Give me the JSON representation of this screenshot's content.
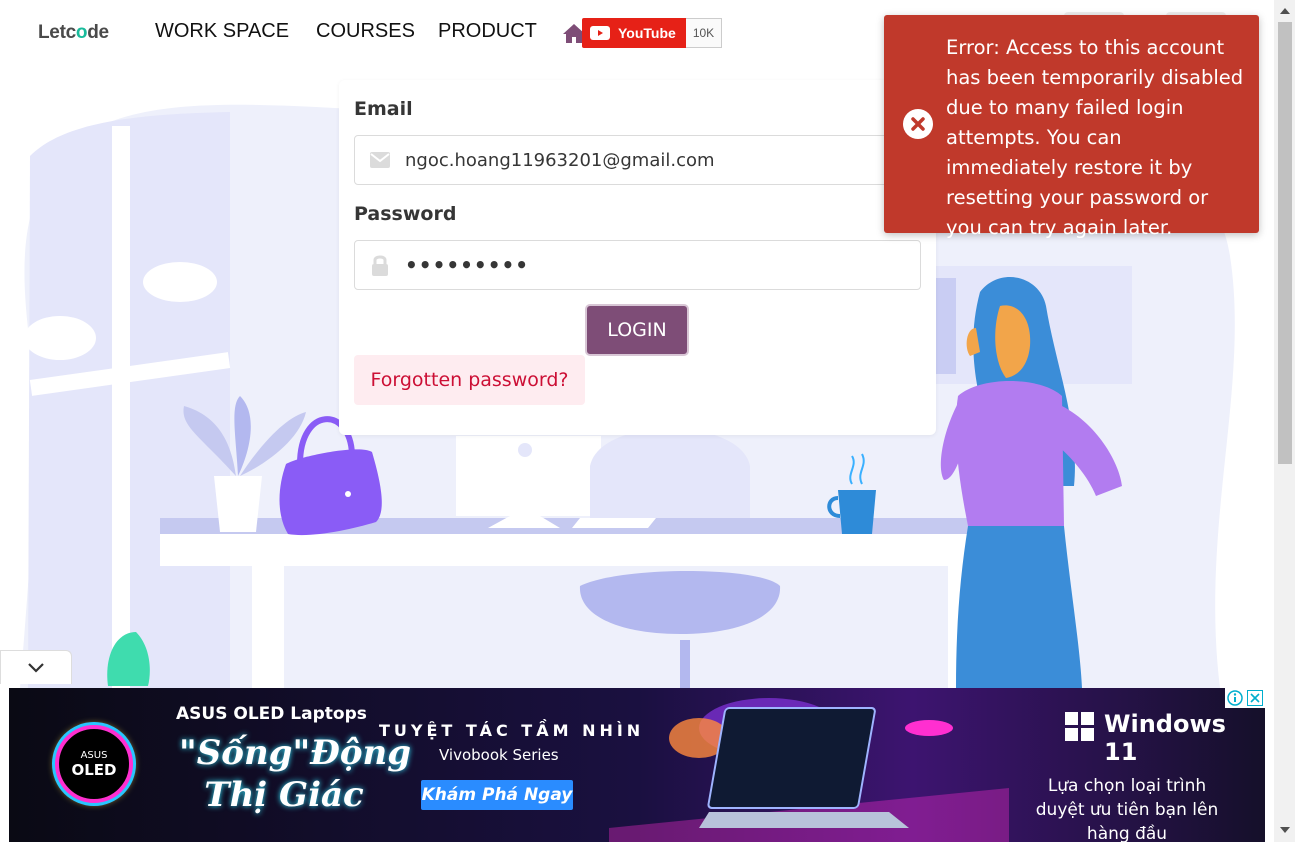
{
  "nav": {
    "logo_pre": "Letc",
    "logo_o": "o",
    "logo_post": "de",
    "links": [
      "WORK SPACE",
      "COURSES",
      "PRODUCT"
    ],
    "youtube_label": "YouTube",
    "youtube_count": "10K"
  },
  "login": {
    "email_label": "Email",
    "email_value": "ngoc.hoang11963201@gmail.com",
    "password_label": "Password",
    "password_value": "•••••••••",
    "login_button": "LOGIN",
    "forgot_link": "Forgotten password?"
  },
  "toast": {
    "message": "Error: Access to this account has been temporarily disabled due to many failed login attempts. You can immediately restore it by resetting your password or you can try again later.",
    "color": "#c0392b"
  },
  "ad": {
    "brand": "ASUS OLED Laptops",
    "slogan": "\"Sống\"Động Thị Giác",
    "tagline": "TUYỆT TÁC TẦM NHÌN",
    "series": "Vivobook Series",
    "cta": "Khám Phá Ngay",
    "windows": "Windows 11",
    "description": "Lựa chọn loại trình duyệt ưu tiên bạn lên hàng đầu",
    "oled_small": "ASUS",
    "oled_big": "OLED"
  },
  "colors": {
    "accent": "#7e4d77",
    "forgot_text": "#cc0f35",
    "forgot_bg": "#feecf0",
    "youtube": "#e62117"
  }
}
